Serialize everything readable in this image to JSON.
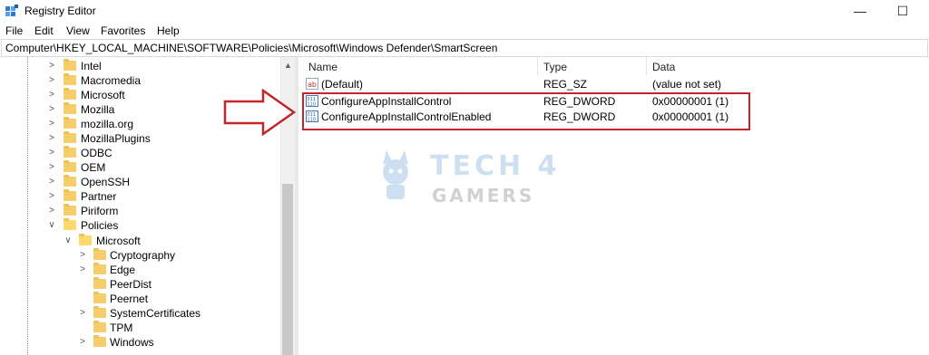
{
  "window": {
    "title": "Registry Editor",
    "minimize_glyph": "—",
    "maximize_glyph": "☐"
  },
  "menu": {
    "items": [
      "File",
      "Edit",
      "View",
      "Favorites",
      "Help"
    ]
  },
  "address": {
    "path": "Computer\\HKEY_LOCAL_MACHINE\\SOFTWARE\\Policies\\Microsoft\\Windows Defender\\SmartScreen"
  },
  "tree": {
    "items": [
      {
        "label": "Intel",
        "expanded": false,
        "level": 1
      },
      {
        "label": "Macromedia",
        "expanded": false,
        "level": 1
      },
      {
        "label": "Microsoft",
        "expanded": false,
        "level": 1
      },
      {
        "label": "Mozilla",
        "expanded": false,
        "level": 1
      },
      {
        "label": "mozilla.org",
        "expanded": false,
        "level": 1
      },
      {
        "label": "MozillaPlugins",
        "expanded": false,
        "level": 1
      },
      {
        "label": "ODBC",
        "expanded": false,
        "level": 1
      },
      {
        "label": "OEM",
        "expanded": false,
        "level": 1
      },
      {
        "label": "OpenSSH",
        "expanded": false,
        "level": 1
      },
      {
        "label": "Partner",
        "expanded": false,
        "level": 1
      },
      {
        "label": "Piriform",
        "expanded": false,
        "level": 1
      },
      {
        "label": "Policies",
        "expanded": true,
        "level": 1
      },
      {
        "label": "Microsoft",
        "expanded": true,
        "level": 2
      },
      {
        "label": "Cryptography",
        "expanded": false,
        "level": 3
      },
      {
        "label": "Edge",
        "expanded": false,
        "level": 3
      },
      {
        "label": "PeerDist",
        "expanded": false,
        "level": 3
      },
      {
        "label": "Peernet",
        "expanded": false,
        "level": 3
      },
      {
        "label": "SystemCertificates",
        "expanded": false,
        "level": 3
      },
      {
        "label": "TPM",
        "expanded": false,
        "level": 3
      },
      {
        "label": "Windows",
        "expanded": false,
        "level": 3
      }
    ]
  },
  "list": {
    "columns": [
      "Name",
      "Type",
      "Data"
    ],
    "rows": [
      {
        "icon": "string-value-icon",
        "name": "(Default)",
        "type": "REG_SZ",
        "data": "(value not set)"
      },
      {
        "icon": "dword-value-icon",
        "name": "ConfigureAppInstallControl",
        "type": "REG_DWORD",
        "data": "0x00000001 (1)"
      },
      {
        "icon": "dword-value-icon",
        "name": "ConfigureAppInstallControlEnabled",
        "type": "REG_DWORD",
        "data": "0x00000001 (1)"
      }
    ]
  },
  "watermark": {
    "line1": "TECH 4",
    "line2": "GAMERS"
  },
  "colors": {
    "highlight": "#c0262c",
    "folder": "#f5cd6a",
    "watermark": "#6fa8d8"
  }
}
